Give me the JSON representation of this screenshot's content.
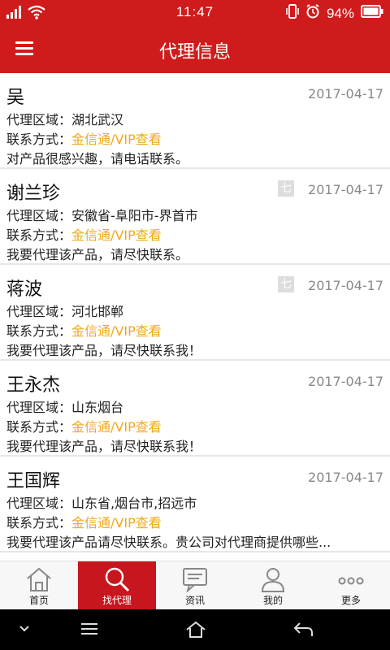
{
  "status": {
    "time": "11:47",
    "battery": "94%"
  },
  "header": {
    "title": "代理信息"
  },
  "items": [
    {
      "name": "吴",
      "date": "2017-04-17",
      "tag": "",
      "region_label": "代理区域：",
      "region": "湖北武汉",
      "contact_label": "联系方式：",
      "contact": "金信通/VIP查看",
      "message": "对产品很感兴趣，请电话联系。"
    },
    {
      "name": "谢兰珍",
      "date": "2017-04-17",
      "tag": "七",
      "region_label": "代理区域：",
      "region": "安徽省-阜阳市-界首市",
      "contact_label": "联系方式：",
      "contact": "金信通/VIP查看",
      "message": "我要代理该产品，请尽快联系。"
    },
    {
      "name": "蒋波",
      "date": "2017-04-17",
      "tag": "七",
      "region_label": "代理区域：",
      "region": "河北邯郸",
      "contact_label": "联系方式：",
      "contact": "金信通/VIP查看",
      "message": "我要代理该产品，请尽快联系我！"
    },
    {
      "name": "王永杰",
      "date": "2017-04-17",
      "tag": "",
      "region_label": "代理区域：",
      "region": "山东烟台",
      "contact_label": "联系方式：",
      "contact": "金信通/VIP查看",
      "message": "我要代理该产品，请尽快联系我！"
    },
    {
      "name": "王国辉",
      "date": "2017-04-17",
      "tag": "",
      "region_label": "代理区域：",
      "region": "山东省,烟台市,招远市",
      "contact_label": "联系方式：",
      "contact": "金信通/VIP查看",
      "message": "我要代理该产品请尽快联系。贵公司对代理商提供哪些..."
    }
  ],
  "tabs": [
    {
      "label": "首页"
    },
    {
      "label": "找代理"
    },
    {
      "label": "资讯"
    },
    {
      "label": "我的"
    },
    {
      "label": "更多"
    }
  ],
  "colors": {
    "brand_red": "#cf1b1b",
    "link_gold": "#f0a81c"
  }
}
